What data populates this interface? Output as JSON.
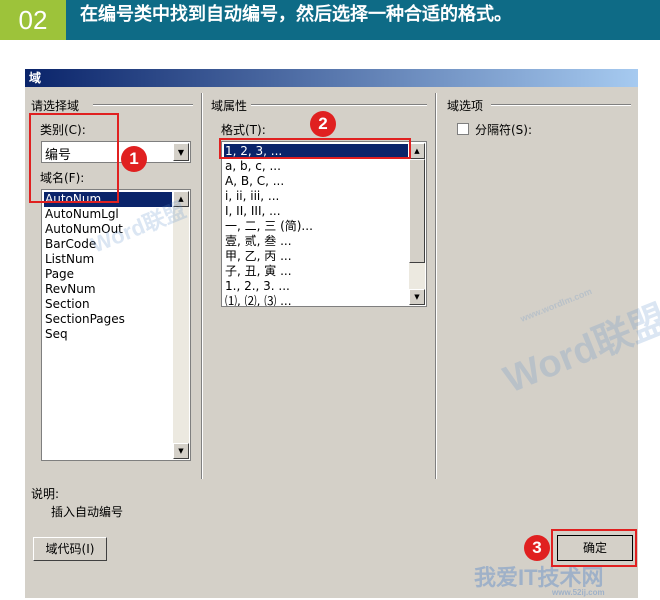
{
  "banner": {
    "step": "02",
    "instruction": "在编号类中找到自动编号，然后选择一种合适的格式。"
  },
  "dialog": {
    "title": "域",
    "left_section": {
      "title": "请选择域",
      "category_label": "类别(C):",
      "category_value": "编号",
      "fieldname_label": "域名(F):",
      "field_names": [
        "AutoNum",
        "AutoNumLgl",
        "AutoNumOut",
        "BarCode",
        "ListNum",
        "Page",
        "RevNum",
        "Section",
        "SectionPages",
        "Seq"
      ],
      "selected_index": 0
    },
    "middle_section": {
      "title": "域属性",
      "format_label": "格式(T):",
      "formats": [
        "1, 2, 3, ...",
        "a, b, c, ...",
        "A, B, C, ...",
        "i, ii, iii, ...",
        "I, II, III, ...",
        "一, 二, 三 (简)...",
        "壹, 贰, 叁 ...",
        "甲, 乙, 丙 ...",
        "子, 丑, 寅 ...",
        "1., 2., 3. ...",
        "⑴, ⑵, ⑶ ..."
      ],
      "selected_index": 0
    },
    "right_section": {
      "title": "域选项",
      "separator_label": "分隔符(S):",
      "separator_checked": false
    },
    "description": {
      "title": "说明:",
      "text": "插入自动编号"
    },
    "field_codes_button": "域代码(I)",
    "ok_button": "确定"
  },
  "annotations": {
    "badge1": "1",
    "badge2": "2",
    "badge3": "3"
  },
  "watermarks": {
    "main": "Word联盟",
    "site_small": "www.wordlm.com",
    "corner": "我爱IT技术网",
    "corner_url": "www.52ij.com"
  },
  "colors": {
    "banner_bg": "#0e6b86",
    "step_bg": "#9dc33a",
    "dialog_bg": "#d4d0c8",
    "selection": "#0a246a",
    "annotation_red": "#e02020"
  }
}
